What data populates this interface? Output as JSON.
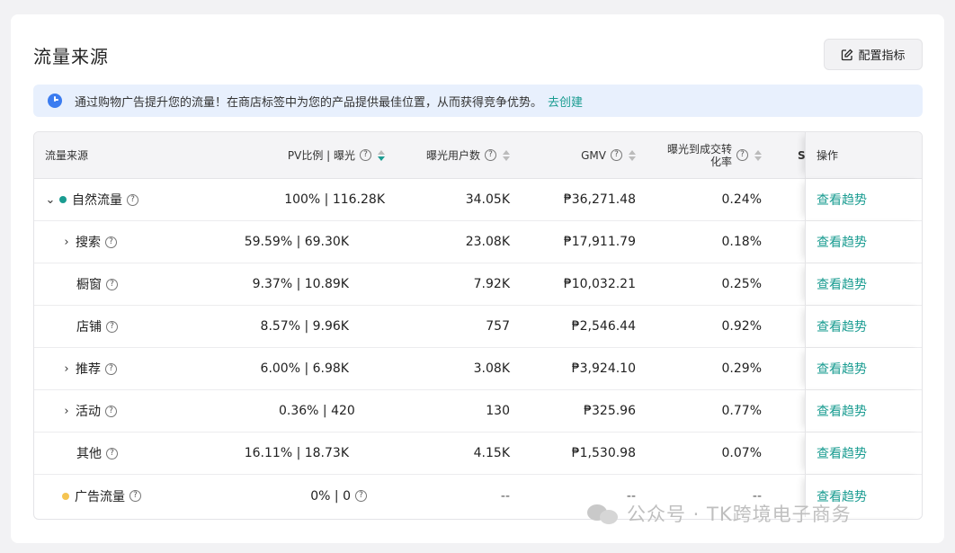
{
  "page": {
    "title": "流量来源",
    "config_button": "配置指标"
  },
  "notice": {
    "text": "通过购物广告提升您的流量！在商店标签中为您的产品提供最佳位置，从而获得竞争优势。",
    "link": "去创建"
  },
  "table": {
    "headers": {
      "source": "流量来源",
      "pv": "PV比例 | 曝光",
      "uv": "曝光用户数",
      "gmv": "GMV",
      "cvr_line1": "曝光到成交转",
      "cvr_line2": "化率",
      "s": "S",
      "op": "操作"
    },
    "rows": [
      {
        "label": "自然流量",
        "pv": "100% | 116.28K",
        "uv": "34.05K",
        "gmv": "₱36,271.48",
        "cvr": "0.24%",
        "op": "查看趋势"
      },
      {
        "label": "搜索",
        "pv": "59.59% | 69.30K",
        "uv": "23.08K",
        "gmv": "₱17,911.79",
        "cvr": "0.18%",
        "op": "查看趋势"
      },
      {
        "label": "橱窗",
        "pv": "9.37% | 10.89K",
        "uv": "7.92K",
        "gmv": "₱10,032.21",
        "cvr": "0.25%",
        "op": "查看趋势"
      },
      {
        "label": "店铺",
        "pv": "8.57% | 9.96K",
        "uv": "757",
        "gmv": "₱2,546.44",
        "cvr": "0.92%",
        "op": "查看趋势"
      },
      {
        "label": "推荐",
        "pv": "6.00% | 6.98K",
        "uv": "3.08K",
        "gmv": "₱3,924.10",
        "cvr": "0.29%",
        "op": "查看趋势"
      },
      {
        "label": "活动",
        "pv": "0.36% | 420",
        "uv": "130",
        "gmv": "₱325.96",
        "cvr": "0.77%",
        "op": "查看趋势"
      },
      {
        "label": "其他",
        "pv": "16.11% | 18.73K",
        "uv": "4.15K",
        "gmv": "₱1,530.98",
        "cvr": "0.07%",
        "op": "查看趋势"
      },
      {
        "label": "广告流量",
        "pv": "0% | 0",
        "uv": "--",
        "gmv": "--",
        "cvr": "--",
        "op": "查看趋势"
      }
    ]
  },
  "watermark": "公众号 · TK跨境电子商务",
  "colors": {
    "accent": "#1a9c91",
    "organic_dot": "#1a9c91",
    "ads_dot": "#f5c451",
    "info": "#3b7cf0"
  }
}
